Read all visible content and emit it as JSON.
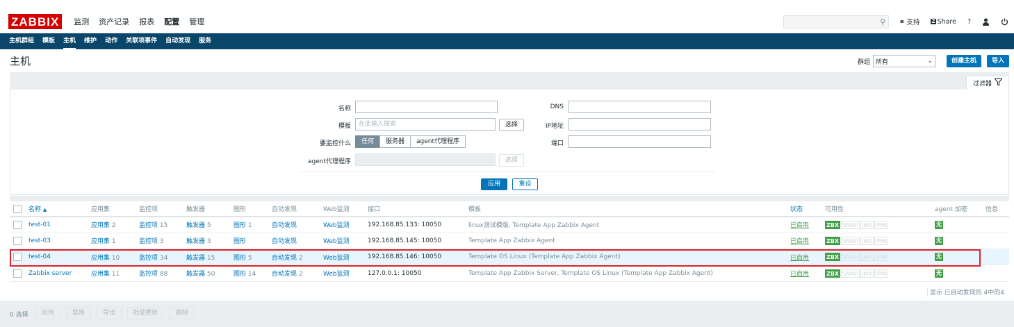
{
  "logo": "ZABBIX",
  "main_menu": [
    {
      "label": "监测",
      "active": false
    },
    {
      "label": "资产记录",
      "active": false
    },
    {
      "label": "报表",
      "active": false
    },
    {
      "label": "配置",
      "active": true
    },
    {
      "label": "管理",
      "active": false
    }
  ],
  "top_right": {
    "support": "支持",
    "share": "Share",
    "help": "?"
  },
  "sub_menu": [
    {
      "label": "主机群组",
      "active": false
    },
    {
      "label": "模板",
      "active": false
    },
    {
      "label": "主机",
      "active": true
    },
    {
      "label": "维护",
      "active": false
    },
    {
      "label": "动作",
      "active": false
    },
    {
      "label": "关联项事件",
      "active": false
    },
    {
      "label": "自动发现",
      "active": false
    },
    {
      "label": "服务",
      "active": false
    }
  ],
  "header": {
    "title": "主机",
    "group_label": "群组",
    "group_value": "所有",
    "create_button": "创建主机",
    "import_button": "导入"
  },
  "filter": {
    "tab_label": "过滤器",
    "name_label": "名称",
    "template_label": "模板",
    "template_placeholder": "在此输入搜索",
    "select_button": "选择",
    "monitor_label": "要监控什么",
    "monitor_options": [
      "任何",
      "服务器",
      "agent代理程序"
    ],
    "proxy_label": "agent代理程序",
    "proxy_select_button": "选择",
    "dns_label": "DNS",
    "ip_label": "IP地址",
    "port_label": "端口",
    "apply_button": "应用",
    "reset_button": "重设"
  },
  "table": {
    "headers": {
      "name": "名称",
      "sort_arrow": "▲",
      "apps": "应用集",
      "items": "监控项",
      "triggers": "触发器",
      "graphs": "图形",
      "discovery": "自动发现",
      "web": "Web监测",
      "interface": "接口",
      "templates": "模板",
      "status": "状态",
      "availability": "可用性",
      "encryption": "agent 加密",
      "info": "信息"
    },
    "rows": [
      {
        "name": "test-01",
        "apps": "应用集",
        "apps_count": "2",
        "items": "监控项",
        "items_count": "15",
        "triggers": "触发器",
        "triggers_count": "5",
        "graphs": "图形",
        "graphs_count": "1",
        "discovery": "自动发现",
        "discovery_count": "",
        "web": "Web监测",
        "interface": "192.168.85.133: 10050",
        "templates": "linux测试模版, Template App Zabbix Agent",
        "status": "已启用",
        "encryption": "无"
      },
      {
        "name": "test-03",
        "apps": "应用集",
        "apps_count": "1",
        "items": "监控项",
        "items_count": "3",
        "triggers": "触发器",
        "triggers_count": "3",
        "graphs": "图形",
        "graphs_count": "",
        "discovery": "自动发现",
        "discovery_count": "",
        "web": "Web监测",
        "interface": "192.168.85.145: 10050",
        "templates": "Template App Zabbix Agent",
        "status": "已启用",
        "encryption": "无"
      },
      {
        "name": "test-04",
        "apps": "应用集",
        "apps_count": "10",
        "items": "监控项",
        "items_count": "34",
        "triggers": "触发器",
        "triggers_count": "15",
        "graphs": "图形",
        "graphs_count": "5",
        "discovery": "自动发现",
        "discovery_count": "2",
        "web": "Web监测",
        "interface": "192.168.85.146: 10050",
        "templates": "Template OS Linux (Template App Zabbix Agent)",
        "status": "已启用",
        "encryption": "无"
      },
      {
        "name": "Zabbix server",
        "apps": "应用集",
        "apps_count": "11",
        "items": "监控项",
        "items_count": "88",
        "triggers": "触发器",
        "triggers_count": "50",
        "graphs": "图形",
        "graphs_count": "14",
        "discovery": "自动发现",
        "discovery_count": "2",
        "web": "Web监测",
        "interface": "127.0.0.1: 10050",
        "templates": "Template App Zabbix Server, Template OS Linux (Template App Zabbix Agent)",
        "status": "已启用",
        "encryption": "无"
      }
    ],
    "availability_badges": [
      "ZBX",
      "SNMP",
      "JMX",
      "IPMI"
    ]
  },
  "summary": "显示 已自动发现的 4中的4",
  "footer": {
    "selected": "0 选择",
    "buttons": [
      "启用",
      "禁用",
      "导出",
      "批量更新",
      "删除"
    ]
  }
}
